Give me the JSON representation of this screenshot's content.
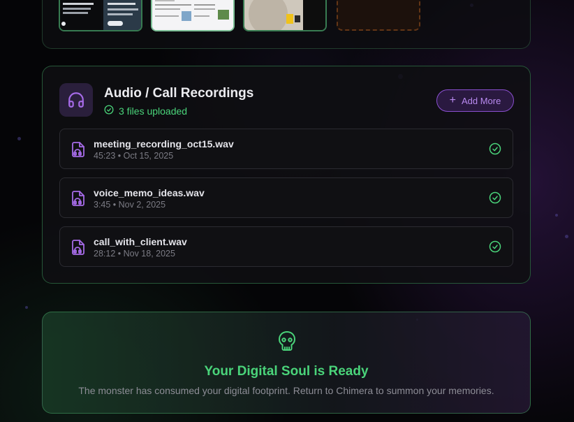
{
  "audio": {
    "title": "Audio / Call Recordings",
    "status": "3 files uploaded",
    "add_more_label": "Add More",
    "files": [
      {
        "name": "meeting_recording_oct15.wav",
        "meta": "45:23 • Oct 15, 2025"
      },
      {
        "name": "voice_memo_ideas.wav",
        "meta": "3:45 • Nov 2, 2025"
      },
      {
        "name": "call_with_client.wav",
        "meta": "28:12 • Nov 18, 2025"
      }
    ]
  },
  "ready": {
    "title": "Your Digital Soul is Ready",
    "description": "The monster has consumed your digital footprint. Return to Chimera to summon your memories."
  },
  "icons": {
    "audio_section": "headphones-icon",
    "status": "check-circle-icon",
    "add": "plus-icon",
    "file": "audio-file-icon",
    "file_status": "check-circle-icon",
    "ready": "skull-icon"
  },
  "colors": {
    "accent_green": "#4ad47a",
    "accent_purple": "#a66be8",
    "background": "#050507"
  }
}
